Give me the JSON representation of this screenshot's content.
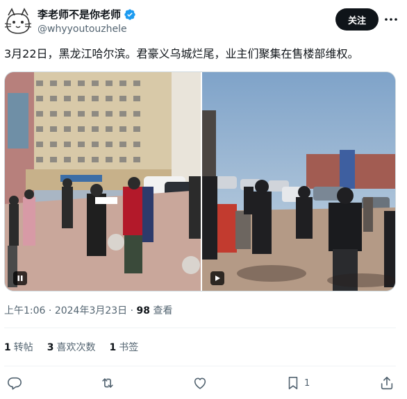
{
  "author": {
    "display_name": "李老师不是你老师",
    "handle": "@whyyoutouzhele",
    "verified": true,
    "avatar_icon": "cat-sketch-avatar"
  },
  "follow_button": {
    "label": "关注"
  },
  "more_icon": "more-horizontal-icon",
  "tweet": {
    "text": "3月22日，黑龙江哈尔滨。君豪义乌城烂尾，业主们聚集在售楼部维权。"
  },
  "media": {
    "left_badge": "pause-icon",
    "right_badge": "play-icon"
  },
  "meta": {
    "time": "上午1:06",
    "separator": "·",
    "date": "2024年3月23日",
    "views_count": "98",
    "views_label": "查看"
  },
  "stats": [
    {
      "count": "1",
      "label": "转帖"
    },
    {
      "count": "3",
      "label": "喜欢次数"
    },
    {
      "count": "1",
      "label": "书签"
    }
  ],
  "actions": {
    "reply_icon": "reply-icon",
    "retweet_icon": "retweet-icon",
    "like_icon": "heart-icon",
    "bookmark_icon": "bookmark-icon",
    "bookmark_count": "1",
    "share_icon": "share-icon"
  },
  "colors": {
    "text_primary": "#0f1419",
    "text_secondary": "#536471",
    "verified_blue": "#1d9bf0",
    "follow_bg": "#0f1419",
    "divider": "#eff3f4"
  }
}
